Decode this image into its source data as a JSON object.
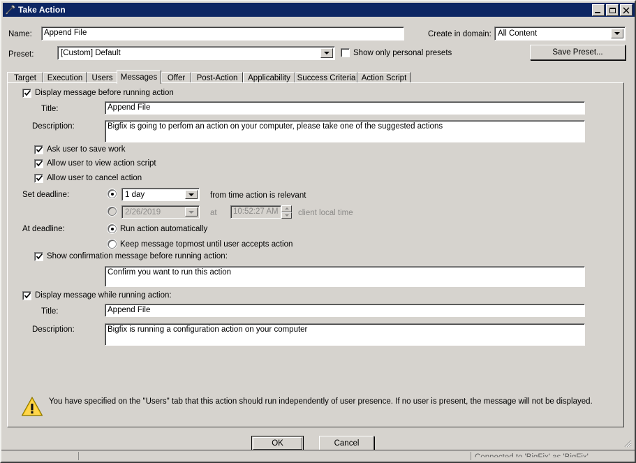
{
  "window": {
    "title": "Take Action",
    "icon": "wrench-icon",
    "minimize_label": "Minimize",
    "maximize_label": "Maximize",
    "close_label": "Close"
  },
  "colors": {
    "titlebar": "#0d2663",
    "face": "#d6d3ce",
    "warning": "#f5c518",
    "field": "#ffffff",
    "disabled_text": "#8b8a88"
  },
  "form": {
    "name_label": "Name:",
    "name_value": "Append File",
    "domain_label": "Create in domain:",
    "domain_value": "All Content",
    "preset_label": "Preset:",
    "preset_value": "[Custom] Default",
    "show_personal_presets_label": "Show only personal presets",
    "show_personal_presets_checked": false,
    "save_preset_label": "Save Preset..."
  },
  "tabs": [
    {
      "label": "Target",
      "selected": false
    },
    {
      "label": "Execution",
      "selected": false
    },
    {
      "label": "Users",
      "selected": false
    },
    {
      "label": "Messages",
      "selected": true
    },
    {
      "label": "Offer",
      "selected": false
    },
    {
      "label": "Post-Action",
      "selected": false
    },
    {
      "label": "Applicability",
      "selected": false
    },
    {
      "label": "Success Criteria",
      "selected": false
    },
    {
      "label": "Action Script",
      "selected": false
    }
  ],
  "messages": {
    "display_before_label": "Display message before running action",
    "display_before_checked": true,
    "before_title_label": "Title:",
    "before_title_value": "Append File",
    "before_desc_label": "Description:",
    "before_desc_value": "Bigfix is going to perfom an action on your computer, please take one of the suggested actions",
    "ask_save_label": "Ask user to save work",
    "ask_save_checked": true,
    "allow_view_label": "Allow user to view action script",
    "allow_view_checked": true,
    "allow_cancel_label": "Allow user to cancel action",
    "allow_cancel_checked": true,
    "set_deadline_label": "Set deadline:",
    "deadline_relative_selected": true,
    "deadline_relative_value": "1 day",
    "deadline_relative_suffix": "from time action is relevant",
    "deadline_absolute_selected": false,
    "deadline_absolute_date": "2/26/2019",
    "deadline_at_label": "at",
    "deadline_absolute_time": "10:52:27 AM",
    "deadline_absolute_suffix": "client local time",
    "at_deadline_label": "At deadline:",
    "run_auto_label": "Run action automatically",
    "run_auto_selected": true,
    "keep_topmost_label": "Keep message topmost until user accepts action",
    "keep_topmost_selected": false,
    "show_confirm_label": "Show confirmation message before running action:",
    "show_confirm_checked": true,
    "confirm_value": "Confirm you want to run this  action",
    "display_while_label": "Display message while running action:",
    "display_while_checked": true,
    "while_title_label": "Title:",
    "while_title_value": "Append File",
    "while_desc_label": "Description:",
    "while_desc_value": "Bigfix is running a configuration action on your computer"
  },
  "warning": {
    "icon": "warning-triangle-icon",
    "text": "You have specified on the \"Users\" tab that this action should run independently of user presence. If no user is present, the message will not be displayed."
  },
  "footer": {
    "ok_label": "OK",
    "cancel_label": "Cancel"
  },
  "statusbar": {
    "text": "Connected to 'BigFix' as 'BigFix'"
  }
}
